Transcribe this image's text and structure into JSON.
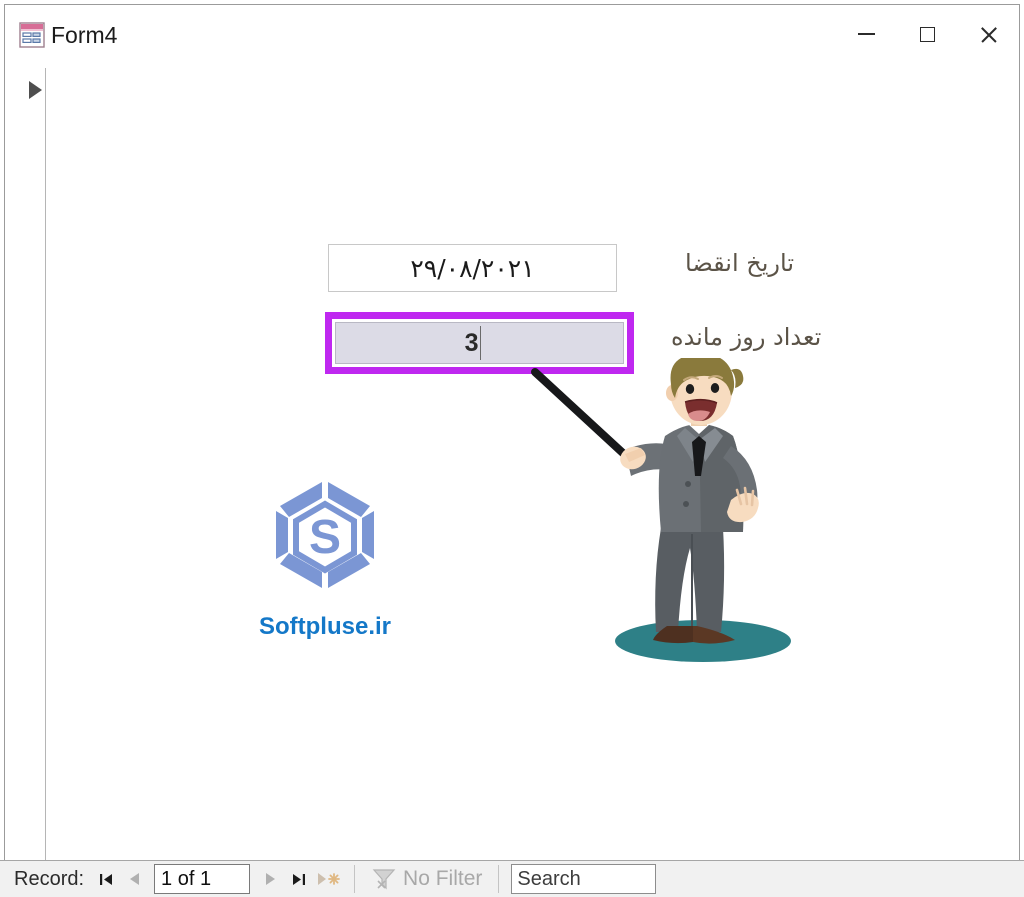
{
  "window": {
    "title": "Form4",
    "icon": "access-form-icon",
    "controls": {
      "minimize": "–",
      "maximize": "□",
      "close": "✕"
    }
  },
  "form": {
    "record_selector": "record-selector-arrow",
    "expiry_label": "تاریخ انقضا",
    "expiry_value": "۲۹/۰۸/۲۰۲۱",
    "days_remaining_label": "تعداد روز  مانده",
    "days_remaining_value": "3",
    "focus_border_color": "#bf28f0",
    "field_fill_color": "#dcdbe6",
    "logo": {
      "mark": "softpluse-hexagon-s-logo",
      "text": "Softpluse.ir",
      "text_color": "#1478c8",
      "mark_color": "#7b96d4"
    },
    "illustration": {
      "name": "cartoon-presenter-with-pointer",
      "suit_color": "#5f6468",
      "shadow_color": "#2e8087"
    }
  },
  "statusbar": {
    "record_label": "Record:",
    "first_icon": "first-record-icon",
    "previous_icon": "previous-record-icon",
    "position": "1 of 1",
    "next_icon": "next-record-icon",
    "last_icon": "last-record-icon",
    "new_icon": "new-record-icon",
    "filter_icon": "filter-funnel-icon",
    "filter_label": "No Filter",
    "search_value": "Search"
  }
}
